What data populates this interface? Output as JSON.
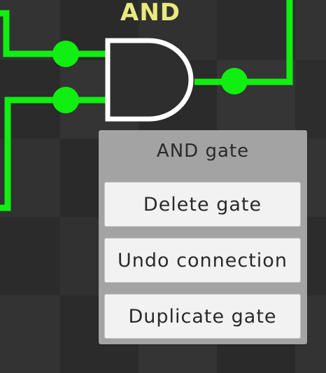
{
  "gate": {
    "title": "AND",
    "type": "AND gate"
  },
  "context_menu": {
    "title": "AND gate",
    "buttons": [
      {
        "label": "Delete gate"
      },
      {
        "label": "Undo connection"
      },
      {
        "label": "Duplicate gate"
      }
    ]
  },
  "colors": {
    "background": "#2f2f2f",
    "wire": "#11ee11",
    "gate_outline": "#ffffff",
    "gate_label": "#e8ea7e",
    "menu_background": "#a3a3a3",
    "button_background": "#f2f2f2"
  }
}
